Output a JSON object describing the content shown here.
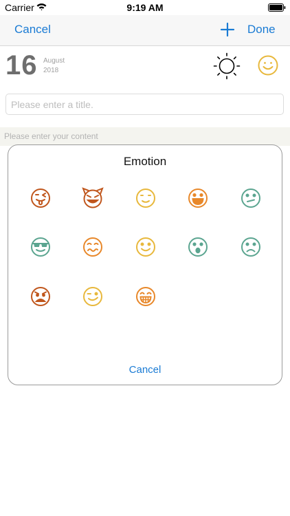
{
  "status_bar": {
    "carrier": "Carrier",
    "time": "9:19 AM",
    "wifi_icon": "wifi-icon",
    "battery_icon": "battery-icon"
  },
  "nav": {
    "cancel_label": "Cancel",
    "add_icon": "plus-icon",
    "done_label": "Done",
    "accent_color": "#1a7bd4"
  },
  "date": {
    "day": "16",
    "month": "August",
    "year": "2018"
  },
  "header_icons": {
    "weather": "sun-icon",
    "mood": "smile-icon"
  },
  "title_input": {
    "value": "",
    "placeholder": "Please enter a title."
  },
  "content": {
    "placeholder": "Please enter your content"
  },
  "emotion_picker": {
    "title": "Emotion",
    "cancel_label": "Cancel",
    "emotions": [
      {
        "icon": "tongue-out-face-icon",
        "color": "#c0561c"
      },
      {
        "icon": "devil-face-icon",
        "color": "#c0561c"
      },
      {
        "icon": "content-face-icon",
        "color": "#e8b83c"
      },
      {
        "icon": "laughing-face-icon",
        "color": "#e8882a"
      },
      {
        "icon": "skeptical-face-icon",
        "color": "#5ba590"
      },
      {
        "icon": "cool-sunglasses-face-icon",
        "color": "#5ba590"
      },
      {
        "icon": "woozy-face-icon",
        "color": "#e8882a"
      },
      {
        "icon": "happy-face-icon",
        "color": "#e8b83c"
      },
      {
        "icon": "surprised-face-icon",
        "color": "#5ba590"
      },
      {
        "icon": "sad-face-icon",
        "color": "#5ba590"
      },
      {
        "icon": "angry-face-icon",
        "color": "#c0561c"
      },
      {
        "icon": "winking-face-icon",
        "color": "#e8b83c"
      },
      {
        "icon": "grinning-face-icon",
        "color": "#e8882a"
      }
    ]
  }
}
